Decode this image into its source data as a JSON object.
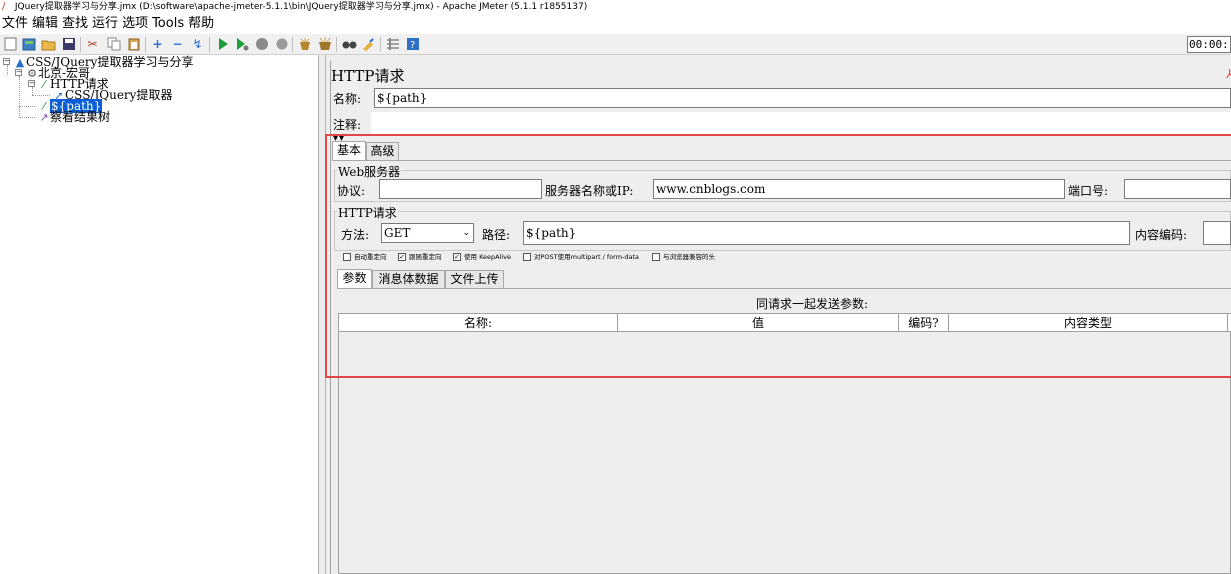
{
  "window": {
    "title": "JQuery提取器学习与分享.jmx (D:\\software\\apache-jmeter-5.1.1\\bin\\JQuery提取器学习与分享.jmx) - Apache JMeter (5.1.1 r1855137)"
  },
  "menu": {
    "file": "文件",
    "edit": "编辑",
    "search": "查找",
    "run": "运行",
    "options": "选项",
    "tools": "Tools",
    "help": "帮助"
  },
  "toolbar": {
    "timer": "00:00:"
  },
  "tree": {
    "root": "CSS/JQuery提取器学习与分享",
    "thread_group": "北京-宏哥",
    "http_request": "HTTP请求",
    "extractor": "CSS/JQuery提取器",
    "selected_sampler": "${path}",
    "result_tree": "察看结果树"
  },
  "panel": {
    "title": "HTTP请求",
    "name_label": "名称:",
    "name_value": "${path}",
    "comment_label": "注释:",
    "comment_value": "",
    "tab_basic": "基本",
    "tab_advanced": "高级",
    "web_server": {
      "legend": "Web服务器",
      "protocol_label": "协议:",
      "protocol_value": "",
      "server_label": "服务器名称或IP:",
      "server_value": "www.cnblogs.com",
      "port_label": "端口号:",
      "port_value": ""
    },
    "http_request": {
      "legend": "HTTP请求",
      "method_label": "方法:",
      "method_value": "GET",
      "path_label": "路径:",
      "path_value": "${path}",
      "encoding_label": "内容编码:",
      "encoding_value": ""
    },
    "checkboxes": [
      {
        "label": "自动重定向",
        "checked": false
      },
      {
        "label": "跟随重定向",
        "checked": true
      },
      {
        "label": "使用 KeepAlive",
        "checked": true
      },
      {
        "label": "对POST使用multipart / form-data",
        "checked": false
      },
      {
        "label": "与浏览器兼容的头",
        "checked": false
      }
    ],
    "subtabs": {
      "params": "参数",
      "body": "消息体数据",
      "files": "文件上传"
    },
    "params_caption": "同请求一起发送参数:",
    "table_headers": {
      "name": "名称:",
      "value": "值",
      "encode": "编码?",
      "content_type": "内容类型"
    }
  }
}
